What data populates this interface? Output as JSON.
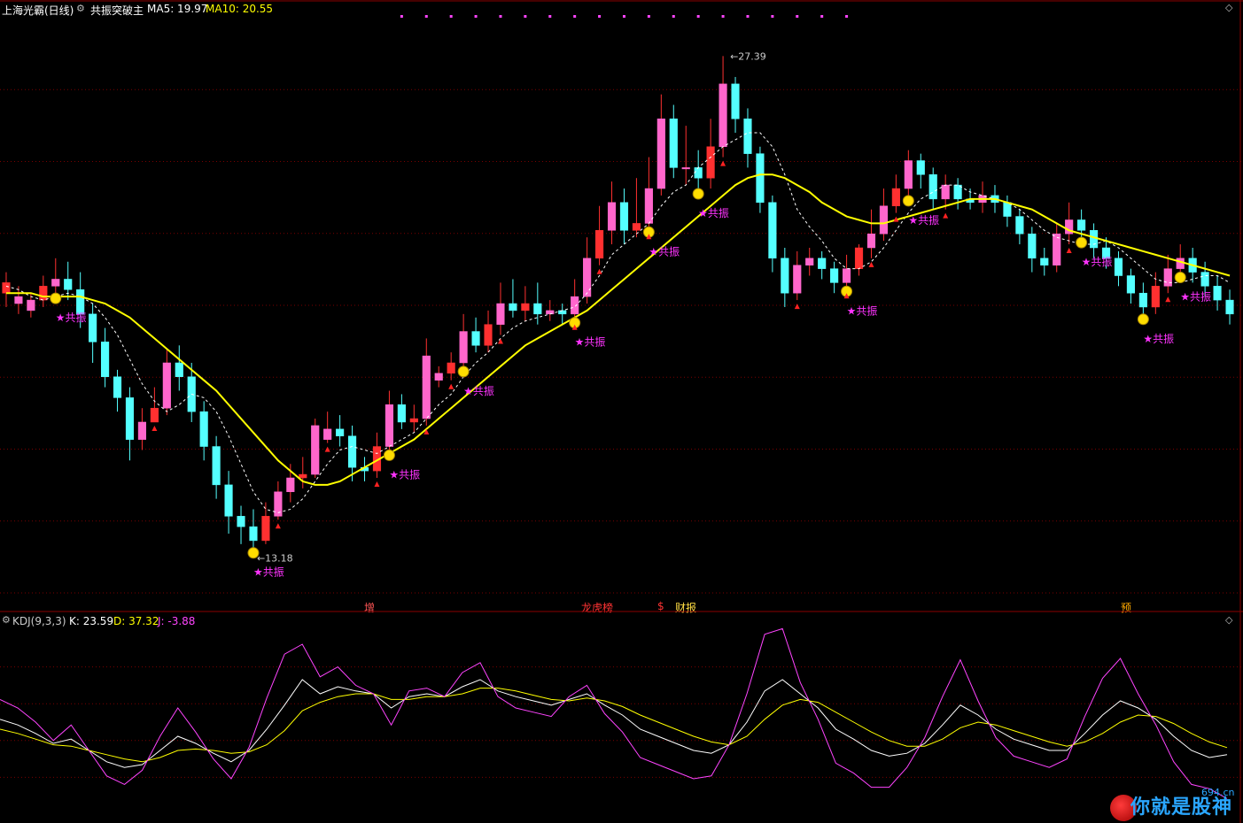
{
  "header": {
    "stock_name": "上海光霸(日线)",
    "indicator_name": "共振突破主",
    "ma5_label": "MA5: 19.97",
    "ma10_label": "MA10: 20.55",
    "colors": {
      "stock": "#ffffff",
      "ma5": "#ffffff",
      "ma10": "#ffff00"
    }
  },
  "kdj_header": {
    "name": "KDJ(9,3,3)",
    "k_label": "K: 23.59",
    "d_label": "D: 37.32",
    "j_label": "J: -3.88",
    "colors": {
      "k": "#ffffff",
      "d": "#ffff00",
      "j": "#ff44ff"
    }
  },
  "annotations": {
    "high": "27.39",
    "low": "13.18",
    "signal": "★共振"
  },
  "events": [
    {
      "label": "增",
      "color": "#ff5555"
    },
    {
      "label": "龙虎榜",
      "color": "#ff3333"
    },
    {
      "label": "$",
      "color": "#ff3333"
    },
    {
      "label": "财报",
      "color": "#ffdd44"
    },
    {
      "label": "预",
      "color": "#ffaa00"
    }
  ],
  "watermark": {
    "text": "你就是股神",
    "site": "694.cn"
  },
  "chart_data": [
    {
      "type": "candlestick",
      "ylim": [
        12.0,
        28.5
      ],
      "grid": true,
      "candles": [
        [
          20.6,
          20.9,
          20.2,
          21.2
        ],
        [
          20.3,
          20.5,
          20.0,
          20.8
        ],
        [
          20.1,
          20.4,
          19.9,
          20.6
        ],
        [
          20.4,
          20.8,
          20.2,
          21.1
        ],
        [
          20.8,
          21.0,
          20.5,
          21.6
        ],
        [
          21.0,
          20.7,
          20.4,
          21.5
        ],
        [
          20.7,
          20.0,
          19.6,
          21.2
        ],
        [
          20.0,
          19.2,
          18.6,
          20.3
        ],
        [
          19.2,
          18.2,
          17.9,
          19.6
        ],
        [
          18.2,
          17.6,
          17.2,
          18.4
        ],
        [
          17.6,
          16.4,
          15.8,
          17.9
        ],
        [
          16.4,
          16.9,
          16.1,
          17.3
        ],
        [
          16.9,
          17.3,
          16.9,
          17.9
        ],
        [
          17.3,
          18.6,
          17.1,
          19.0
        ],
        [
          18.6,
          18.2,
          17.8,
          19.1
        ],
        [
          18.2,
          17.2,
          16.9,
          18.6
        ],
        [
          17.2,
          16.2,
          15.8,
          17.5
        ],
        [
          16.2,
          15.1,
          14.7,
          16.5
        ],
        [
          15.1,
          14.2,
          13.7,
          15.5
        ],
        [
          14.2,
          13.9,
          13.4,
          14.5
        ],
        [
          13.9,
          13.5,
          13.2,
          14.4
        ],
        [
          13.5,
          14.2,
          13.4,
          14.6
        ],
        [
          14.2,
          14.9,
          14.1,
          15.2
        ],
        [
          14.9,
          15.3,
          14.6,
          15.7
        ],
        [
          15.3,
          15.4,
          15.0,
          15.9
        ],
        [
          15.4,
          16.8,
          15.3,
          17.0
        ],
        [
          16.4,
          16.7,
          16.3,
          17.2
        ],
        [
          16.7,
          16.5,
          16.2,
          17.1
        ],
        [
          16.5,
          15.6,
          15.2,
          16.8
        ],
        [
          15.6,
          15.5,
          15.2,
          15.9
        ],
        [
          15.5,
          16.2,
          15.3,
          16.6
        ],
        [
          16.2,
          17.4,
          16.0,
          17.8
        ],
        [
          17.4,
          16.9,
          16.7,
          17.7
        ],
        [
          16.9,
          17.0,
          16.6,
          17.4
        ],
        [
          17.0,
          18.8,
          16.8,
          19.3
        ],
        [
          18.1,
          18.3,
          17.9,
          18.5
        ],
        [
          18.3,
          18.6,
          18.1,
          18.9
        ],
        [
          18.6,
          19.5,
          18.4,
          20.0
        ],
        [
          19.5,
          19.1,
          18.9,
          19.9
        ],
        [
          19.1,
          19.7,
          18.9,
          20.1
        ],
        [
          19.7,
          20.3,
          19.4,
          20.9
        ],
        [
          20.3,
          20.1,
          19.9,
          21.0
        ],
        [
          20.1,
          20.3,
          19.8,
          20.8
        ],
        [
          20.3,
          20.0,
          19.7,
          20.9
        ],
        [
          20.0,
          20.1,
          19.8,
          20.4
        ],
        [
          20.1,
          20.0,
          19.7,
          20.3
        ],
        [
          20.0,
          20.5,
          19.8,
          21.0
        ],
        [
          20.5,
          21.6,
          20.3,
          22.2
        ],
        [
          21.6,
          22.4,
          21.4,
          23.1
        ],
        [
          22.4,
          23.2,
          22.0,
          23.8
        ],
        [
          23.2,
          22.4,
          22.0,
          23.6
        ],
        [
          22.4,
          22.6,
          22.2,
          23.9
        ],
        [
          22.6,
          23.6,
          22.4,
          24.5
        ],
        [
          23.6,
          25.6,
          23.4,
          26.3
        ],
        [
          25.6,
          24.2,
          23.9,
          26.0
        ],
        [
          24.2,
          24.2,
          23.7,
          25.4
        ],
        [
          24.2,
          23.9,
          23.5,
          24.7
        ],
        [
          23.9,
          24.8,
          23.6,
          25.6
        ],
        [
          24.8,
          26.6,
          24.5,
          27.4
        ],
        [
          26.6,
          25.6,
          25.2,
          26.8
        ],
        [
          25.6,
          24.6,
          24.2,
          25.9
        ],
        [
          24.6,
          23.2,
          22.9,
          24.8
        ],
        [
          23.2,
          21.6,
          21.2,
          23.4
        ],
        [
          21.6,
          20.6,
          20.2,
          21.9
        ],
        [
          20.6,
          21.4,
          20.4,
          21.8
        ],
        [
          21.4,
          21.6,
          21.1,
          21.9
        ],
        [
          21.6,
          21.3,
          21.0,
          21.8
        ],
        [
          21.3,
          20.9,
          20.6,
          21.5
        ],
        [
          20.9,
          21.3,
          20.7,
          21.7
        ],
        [
          21.3,
          21.9,
          21.1,
          22.0
        ],
        [
          21.9,
          22.3,
          21.6,
          23.0
        ],
        [
          22.3,
          23.1,
          22.1,
          23.6
        ],
        [
          23.1,
          23.6,
          22.9,
          24.0
        ],
        [
          23.6,
          24.4,
          23.3,
          24.7
        ],
        [
          24.4,
          24.0,
          23.6,
          24.6
        ],
        [
          24.0,
          23.3,
          23.0,
          24.2
        ],
        [
          23.3,
          23.7,
          23.0,
          24.0
        ],
        [
          23.7,
          23.3,
          23.0,
          23.9
        ],
        [
          23.3,
          23.2,
          23.0,
          23.6
        ],
        [
          23.2,
          23.4,
          22.9,
          23.8
        ],
        [
          23.4,
          23.2,
          22.9,
          23.7
        ],
        [
          23.2,
          22.8,
          22.5,
          23.4
        ],
        [
          22.8,
          22.3,
          22.0,
          23.0
        ],
        [
          22.3,
          21.6,
          21.2,
          22.5
        ],
        [
          21.6,
          21.4,
          21.1,
          21.9
        ],
        [
          21.4,
          22.3,
          21.2,
          22.6
        ],
        [
          22.3,
          22.7,
          22.0,
          23.2
        ],
        [
          22.7,
          22.4,
          22.1,
          23.0
        ],
        [
          22.4,
          21.9,
          21.6,
          22.6
        ],
        [
          21.9,
          21.6,
          21.3,
          22.2
        ],
        [
          21.6,
          21.1,
          20.8,
          21.8
        ],
        [
          21.1,
          20.6,
          20.3,
          21.3
        ],
        [
          20.6,
          20.2,
          19.9,
          20.9
        ],
        [
          20.2,
          20.8,
          20.0,
          21.2
        ],
        [
          20.8,
          21.3,
          20.6,
          21.7
        ],
        [
          21.3,
          21.6,
          21.1,
          22.0
        ],
        [
          21.6,
          21.2,
          20.9,
          21.9
        ],
        [
          21.2,
          20.8,
          20.5,
          21.5
        ],
        [
          20.8,
          20.4,
          20.1,
          21.1
        ],
        [
          20.4,
          20.0,
          19.7,
          20.7
        ]
      ],
      "series": [
        {
          "name": "MA5",
          "line": "dashed",
          "values": [
            20.8,
            20.7,
            20.5,
            20.4,
            20.5,
            20.6,
            20.5,
            20.3,
            19.9,
            19.4,
            18.7,
            18.0,
            17.5,
            17.2,
            17.4,
            17.7,
            17.6,
            17.2,
            16.5,
            15.7,
            14.9,
            14.4,
            14.3,
            14.4,
            14.7,
            15.2,
            15.7,
            16.1,
            16.2,
            16.1,
            16.0,
            16.2,
            16.4,
            16.6,
            17.0,
            17.4,
            17.7,
            18.2,
            18.6,
            18.9,
            19.3,
            19.6,
            19.8,
            19.9,
            20.0,
            20.1,
            20.2,
            20.6,
            21.1,
            21.7,
            22.0,
            22.3,
            22.6,
            23.1,
            23.5,
            23.7,
            24.2,
            24.5,
            24.8,
            25.0,
            25.2,
            25.2,
            24.8,
            24.0,
            23.0,
            22.5,
            22.1,
            21.6,
            21.3,
            21.3,
            21.5,
            21.9,
            22.4,
            22.9,
            23.3,
            23.5,
            23.7,
            23.7,
            23.5,
            23.4,
            23.3,
            23.2,
            23.0,
            22.7,
            22.4,
            22.2,
            22.1,
            22.0,
            22.0,
            22.1,
            21.9,
            21.6,
            21.3,
            21.0,
            20.9,
            20.9,
            21.0,
            21.1,
            21.1,
            20.9
          ]
        },
        {
          "name": "MA10",
          "line": "solid",
          "values": [
            20.6,
            20.6,
            20.6,
            20.5,
            20.5,
            20.5,
            20.5,
            20.4,
            20.3,
            20.1,
            19.9,
            19.6,
            19.3,
            19.0,
            18.7,
            18.4,
            18.1,
            17.8,
            17.4,
            17.0,
            16.6,
            16.2,
            15.8,
            15.5,
            15.2,
            15.1,
            15.1,
            15.2,
            15.4,
            15.6,
            15.8,
            16.0,
            16.2,
            16.4,
            16.7,
            17.0,
            17.3,
            17.6,
            17.9,
            18.2,
            18.5,
            18.8,
            19.1,
            19.3,
            19.5,
            19.7,
            19.9,
            20.1,
            20.4,
            20.7,
            21.0,
            21.3,
            21.6,
            21.9,
            22.2,
            22.5,
            22.8,
            23.1,
            23.4,
            23.7,
            23.9,
            24.0,
            24.0,
            23.9,
            23.7,
            23.5,
            23.2,
            23.0,
            22.8,
            22.7,
            22.6,
            22.6,
            22.7,
            22.8,
            22.9,
            23.0,
            23.1,
            23.2,
            23.3,
            23.3,
            23.3,
            23.2,
            23.1,
            23.0,
            22.8,
            22.6,
            22.4,
            22.3,
            22.2,
            22.1,
            22.0,
            21.9,
            21.8,
            21.7,
            21.6,
            21.5,
            21.4,
            21.3,
            21.2,
            21.1
          ]
        }
      ]
    },
    {
      "type": "line",
      "title": "KDJ(9,3,3)",
      "ylim": [
        -15,
        115
      ],
      "series": [
        {
          "name": "K",
          "values": [
            52,
            48,
            42,
            35,
            38,
            30,
            22,
            18,
            20,
            30,
            40,
            35,
            28,
            22,
            30,
            45,
            62,
            80,
            70,
            75,
            72,
            70,
            60,
            68,
            70,
            68,
            75,
            80,
            72,
            68,
            65,
            62,
            66,
            70,
            62,
            55,
            45,
            40,
            35,
            30,
            28,
            34,
            50,
            72,
            80,
            70,
            60,
            45,
            38,
            30,
            26,
            28,
            35,
            48,
            62,
            55,
            45,
            38,
            34,
            30,
            30,
            42,
            55,
            65,
            60,
            52,
            40,
            30,
            25,
            27
          ]
        },
        {
          "name": "D",
          "values": [
            45,
            42,
            38,
            34,
            33,
            30,
            27,
            24,
            22,
            25,
            30,
            31,
            30,
            28,
            29,
            34,
            44,
            58,
            64,
            68,
            70,
            70,
            66,
            66,
            68,
            68,
            70,
            74,
            74,
            72,
            69,
            66,
            65,
            67,
            65,
            61,
            55,
            50,
            45,
            40,
            36,
            34,
            40,
            52,
            62,
            66,
            64,
            57,
            50,
            43,
            37,
            33,
            33,
            38,
            46,
            50,
            48,
            44,
            40,
            36,
            33,
            36,
            42,
            50,
            55,
            54,
            49,
            42,
            36,
            32
          ]
        },
        {
          "name": "J",
          "values": [
            66,
            60,
            50,
            37,
            48,
            30,
            12,
            6,
            16,
            40,
            60,
            43,
            24,
            10,
            32,
            67,
            98,
            105,
            82,
            89,
            76,
            70,
            48,
            72,
            74,
            68,
            85,
            92,
            68,
            60,
            57,
            54,
            68,
            76,
            56,
            43,
            25,
            20,
            15,
            10,
            12,
            34,
            70,
            112,
            116,
            78,
            52,
            21,
            14,
            4,
            4,
            18,
            39,
            68,
            94,
            65,
            39,
            26,
            22,
            18,
            24,
            54,
            81,
            95,
            70,
            48,
            22,
            6,
            3,
            -4
          ]
        }
      ]
    }
  ]
}
